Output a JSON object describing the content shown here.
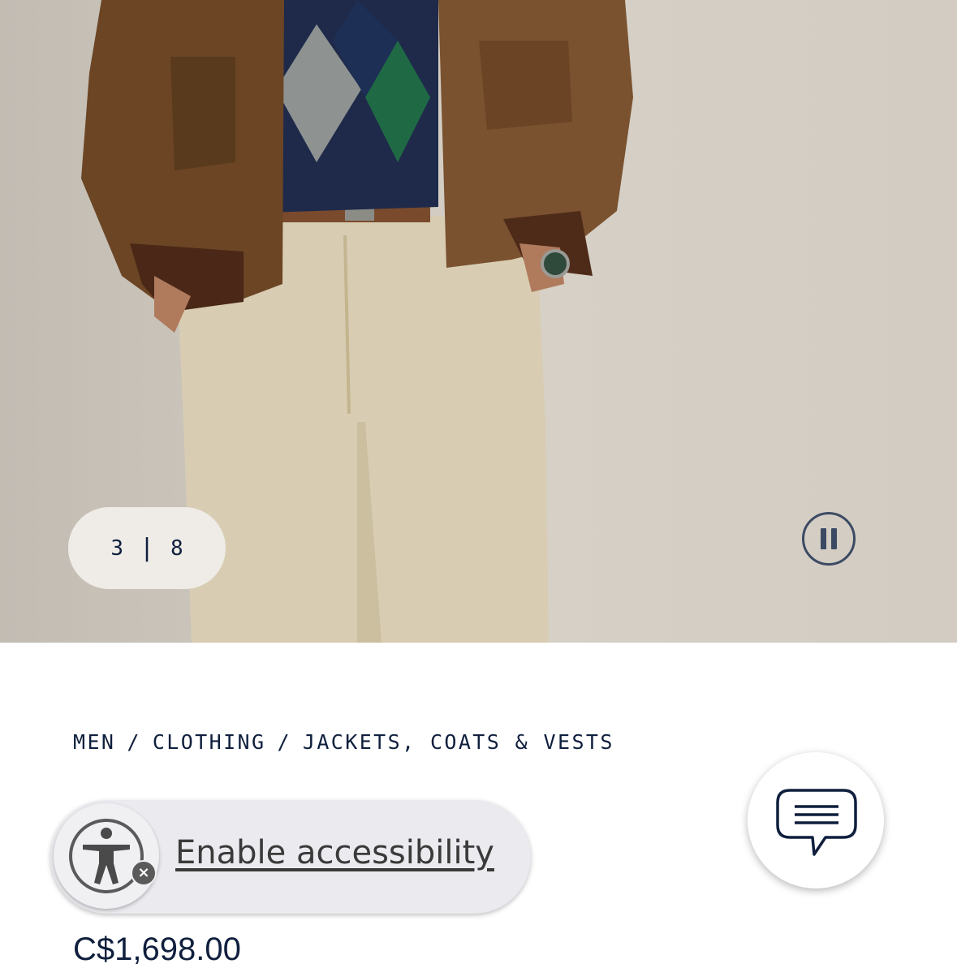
{
  "gallery": {
    "current": "3",
    "separator": "|",
    "total": "8",
    "pause_icon": "pause-icon"
  },
  "breadcrumb": {
    "items": [
      "MEN",
      "CLOTHING",
      "JACKETS, COATS & VESTS"
    ],
    "separator": "/"
  },
  "product": {
    "title_visible": "t",
    "price": "C$1,698.00"
  },
  "accessibility": {
    "label": "Enable accessibility",
    "icon": "accessibility-person-icon",
    "close_icon": "close-icon"
  },
  "chat": {
    "icon": "chat-bubble-icon"
  },
  "colors": {
    "navy": "#0f1f3d",
    "pill_bg": "#eaeaef"
  }
}
